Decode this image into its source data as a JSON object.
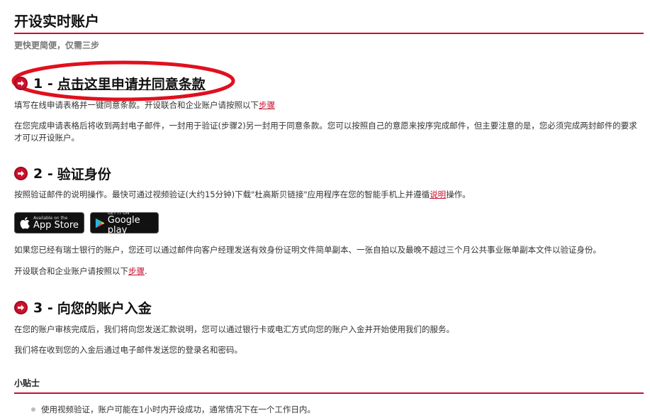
{
  "page": {
    "title": "开设实时账户",
    "subtitle": "更快更简便，仅需三步"
  },
  "step1": {
    "num": "1 -",
    "label": "点击这里申请并同意条款",
    "p1_text": "填写在线申请表格并一键同意条款。开设联合和企业账户请按照以下",
    "p1_link": "步骤",
    "p2": "在您完成申请表格后将收到两封电子邮件，一封用于验证(步骤2)另一封用于同意条款。您可以按照自己的意愿来按序完成邮件，但主要注意的是，您必须完成两封邮件的要求才可以开设账户。"
  },
  "step2": {
    "num": "2 -",
    "label": "验证身份",
    "p1_text": "按照验证邮件的说明操作。最快可通过视频验证(大约15分钟)下载\"杜高斯贝链接\"应用程序在您的智能手机上并遵循",
    "p1_link": "说明",
    "p1_tail": "操作。",
    "appstore_small": "Available on the",
    "appstore_big": "App Store",
    "googleplay_small": "GET IT ON",
    "googleplay_big": "Google play",
    "p2": "如果您已经有瑞士银行的账户，您还可以通过邮件向客户经理发送有效身份证明文件简单副本、一张自拍以及最晚不超过三个月公共事业账单副本文件以验证身份。",
    "p3_text": "开设联合和企业账户请按照以下",
    "p3_link": "步骤",
    "p3_tail": "."
  },
  "step3": {
    "num": "3 -",
    "label": "向您的账户入金",
    "p1": "在您的账户审核完成后，我们将向您发送汇款说明，您可以通过银行卡或电汇方式向您的账户入金并开始使用我们的服务。",
    "p2": "我们将在收到您的入金后通过电子邮件发送您的登录名和密码。"
  },
  "tips": {
    "title": "小贴士",
    "items": [
      "使用视频验证，账户可能在1小时内开设成功，通常情况下在一个工作日内。"
    ]
  }
}
